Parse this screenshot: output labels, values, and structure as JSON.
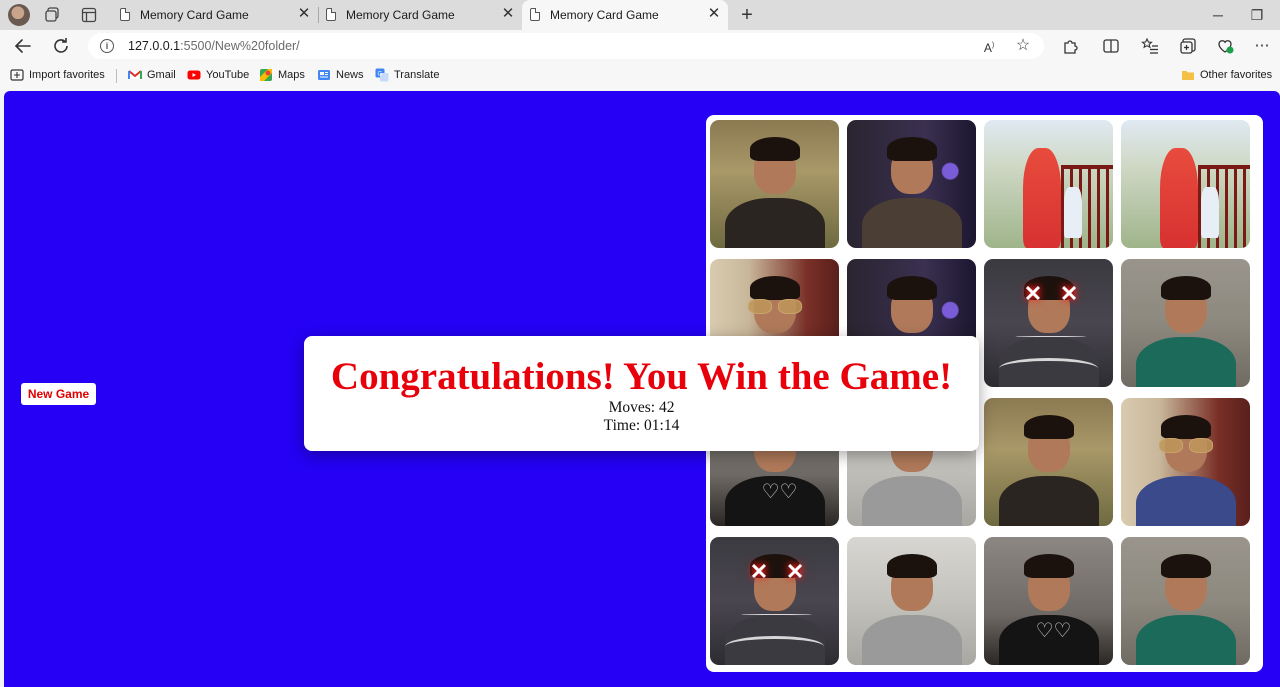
{
  "browser": {
    "tabs": [
      {
        "title": "Memory Card Game",
        "active": false
      },
      {
        "title": "Memory Card Game",
        "active": false
      },
      {
        "title": "Memory Card Game",
        "active": true
      }
    ],
    "address": {
      "host": "127.0.0.1",
      "rest": ":5500/New%20folder/"
    },
    "favorites": [
      {
        "label": "Import favorites",
        "icon": "import-icon"
      },
      {
        "label": "Gmail",
        "icon": "gmail-icon"
      },
      {
        "label": "YouTube",
        "icon": "youtube-icon"
      },
      {
        "label": "Maps",
        "icon": "maps-icon"
      },
      {
        "label": "News",
        "icon": "news-icon"
      },
      {
        "label": "Translate",
        "icon": "translate-icon"
      }
    ],
    "other_favorites": "Other favorites"
  },
  "page": {
    "background": "#2500f5",
    "new_game_label": "New Game",
    "modal": {
      "title": "Congratulations! You Win the Game!",
      "moves_line": "Moves: 42",
      "time_line": "Time: 01:14"
    }
  },
  "board": {
    "cards": [
      {
        "photo": "man-sitting-field"
      },
      {
        "photo": "man-lights-night"
      },
      {
        "photo": "woman-child-railing"
      },
      {
        "photo": "woman-child-railing"
      },
      {
        "photo": "man-sunglasses-curtain"
      },
      {
        "photo": "man-lights-night"
      },
      {
        "photo": "man-glowing-x-eyes"
      },
      {
        "photo": "man-green-kurta"
      },
      {
        "photo": "man-black-tshirt-hearts"
      },
      {
        "photo": "man-denim-jacket"
      },
      {
        "photo": "man-sitting-field"
      },
      {
        "photo": "man-sunglasses-curtain"
      },
      {
        "photo": "man-glowing-x-eyes"
      },
      {
        "photo": "man-denim-jacket"
      },
      {
        "photo": "man-black-tshirt-hearts"
      },
      {
        "photo": "man-green-kurta"
      }
    ]
  }
}
